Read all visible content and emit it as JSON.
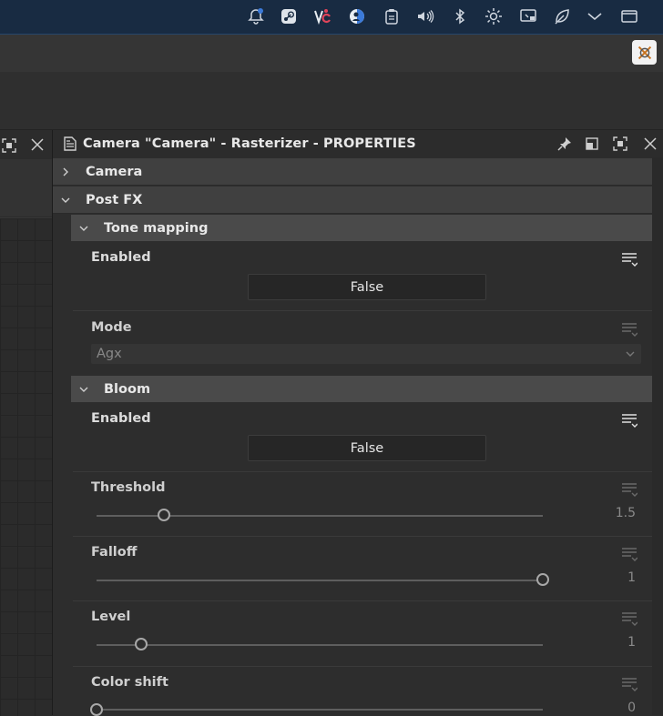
{
  "tray": {
    "icons": [
      "bell-icon",
      "steam-icon",
      "vc-icon",
      "user-icon",
      "clipboard-icon",
      "volume-icon",
      "bluetooth-icon",
      "brightness-icon",
      "screen-icon",
      "leaf-icon",
      "chevron-down-icon",
      "window-icon"
    ]
  },
  "panel": {
    "title": "Camera \"Camera\" - Rasterizer - PROPERTIES",
    "sections": {
      "camera": "Camera",
      "post_fx": "Post FX",
      "tone_mapping": "Tone mapping",
      "bloom": "Bloom"
    },
    "tone_mapping": {
      "enabled_label": "Enabled",
      "enabled_value": "False",
      "mode_label": "Mode",
      "mode_value": "Agx"
    },
    "bloom": {
      "enabled_label": "Enabled",
      "enabled_value": "False",
      "threshold_label": "Threshold",
      "threshold_value": "1.5",
      "threshold_fraction": 0.15,
      "falloff_label": "Falloff",
      "falloff_value": "1",
      "falloff_fraction": 1.0,
      "level_label": "Level",
      "level_value": "1",
      "level_fraction": 0.1,
      "color_shift_label": "Color shift",
      "color_shift_value": "0",
      "color_shift_fraction": 0.0
    }
  },
  "colors": {
    "sysbar": "#182b42",
    "accent_red": "#e0455a",
    "accent_blue": "#3b7ad9"
  }
}
